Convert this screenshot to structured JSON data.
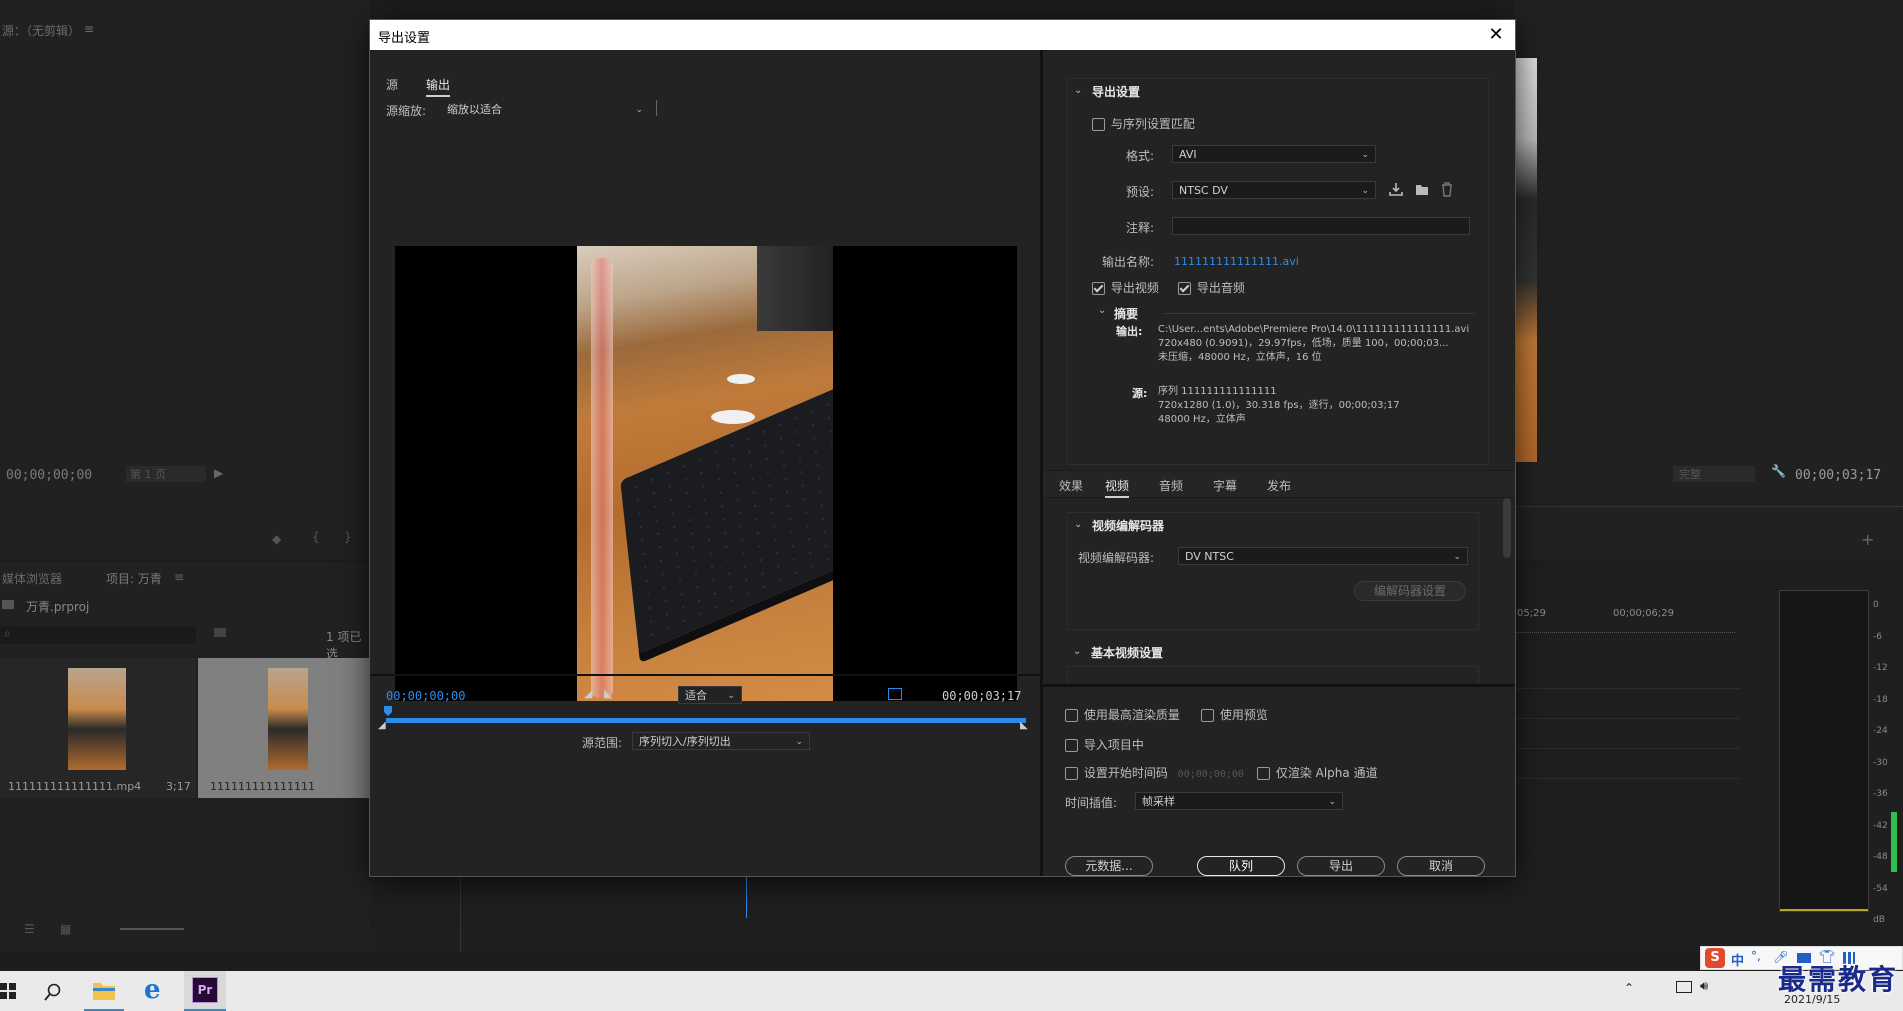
{
  "background": {
    "source_monitor_title": "源：（无剪辑）",
    "source_timecode": "00;00;00;00",
    "source_page": "第 1 页",
    "program_quality": "完整",
    "program_timecode": "00;00;03;17",
    "media_browser_tab": "媒体浏览器",
    "project_tab": "项目: 万青",
    "project_file": "万青.prproj",
    "items_selected": "1 项已选",
    "clip1_name": "111111111111111.mp4",
    "clip1_duration": "3;17",
    "clip2_name": "111111111111111",
    "timeline_ruler": [
      "05;29",
      "00;00;06;29"
    ],
    "meter_scale": [
      "0",
      "-6",
      "-12",
      "-18",
      "-24",
      "-30",
      "-36",
      "-42",
      "-48",
      "-54",
      "dB"
    ]
  },
  "dialog": {
    "title": "导出设置",
    "left": {
      "tabs": [
        "源",
        "输出"
      ],
      "active_tab": "输出",
      "source_scale_label": "源缩放:",
      "source_scale_value": "缩放以适合",
      "timecode_current": "00;00;00;00",
      "fit_value": "适合",
      "timecode_duration": "00;00;03;17",
      "source_range_label": "源范围:",
      "source_range_value": "序列切入/序列切出"
    },
    "export_settings": {
      "section_title": "导出设置",
      "match_sequence": "与序列设置匹配",
      "format_label": "格式:",
      "format_value": "AVI",
      "preset_label": "预设:",
      "preset_value": "NTSC DV",
      "comment_label": "注释:",
      "output_name_label": "输出名称:",
      "output_name_value": "111111111111111.avi",
      "export_video": "导出视频",
      "export_audio": "导出音频",
      "summary_title": "摘要",
      "summary_output_label": "输出:",
      "summary_output_lines": [
        "C:\\User...ents\\Adobe\\Premiere Pro\\14.0\\111111111111111.avi",
        "720x480 (0.9091)，29.97fps，低场，质量 100，00;00;03...",
        "未压缩，48000 Hz，立体声，16 位"
      ],
      "summary_source_label": "源:",
      "summary_source_lines": [
        "序列 111111111111111",
        "720x1280 (1.0)，30.318 fps，逐行，00;00;03;17",
        "48000 Hz，立体声"
      ]
    },
    "settings_tabs": [
      "效果",
      "视频",
      "音频",
      "字幕",
      "发布"
    ],
    "active_settings_tab": "视频",
    "video": {
      "codec_section": "视频编解码器",
      "codec_label": "视频编解码器:",
      "codec_value": "DV NTSC",
      "codec_settings_button": "编解码器设置",
      "basic_section": "基本视频设置"
    },
    "bottom": {
      "max_render_quality": "使用最高渲染质量",
      "use_previews": "使用预览",
      "import_into_project": "导入项目中",
      "set_start_timecode": "设置开始时间码",
      "start_timecode_value": "00;00;00;00",
      "render_alpha_only": "仅渲染 Alpha 通道",
      "time_interpolation_label": "时间插值:",
      "time_interpolation_value": "帧采样",
      "metadata_button": "元数据...",
      "queue_button": "队列",
      "export_button": "导出",
      "cancel_button": "取消"
    }
  },
  "taskbar": {
    "ime_label": "中",
    "date": "2021/9/15",
    "watermark": "最需教育"
  },
  "colors": {
    "accent_blue": "#2d8ceb",
    "dialog_bg": "#232323",
    "taskbar_bg": "#eaeaea"
  }
}
